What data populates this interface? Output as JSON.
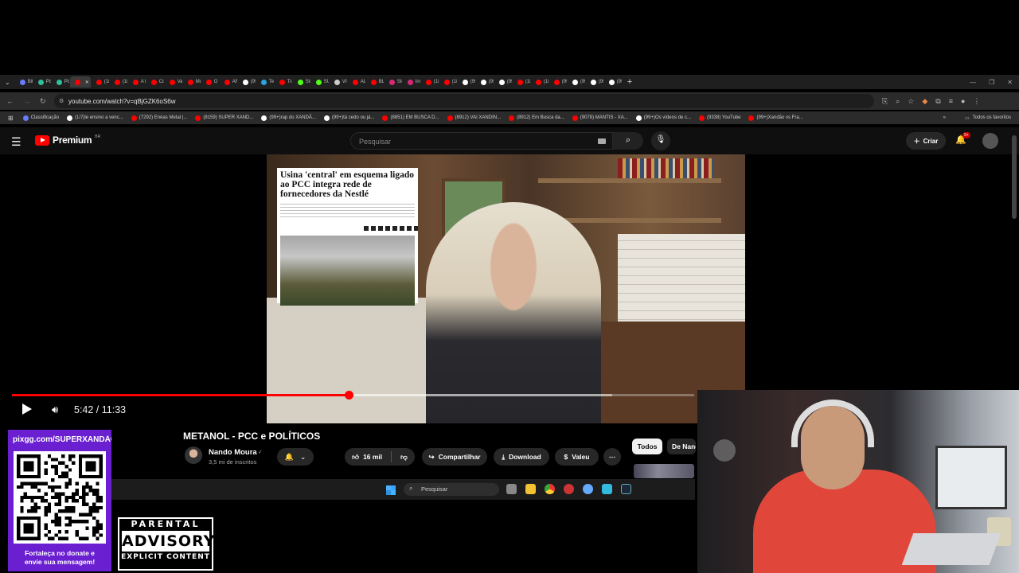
{
  "browser": {
    "tabs": [
      {
        "label": "Bit",
        "color": "#6a7bff"
      },
      {
        "label": "Pix",
        "color": "#2fbf9a"
      },
      {
        "label": "Pix",
        "color": "#2fbf9a"
      },
      {
        "label": "",
        "color": "#ff0000",
        "active": true
      },
      {
        "label": "(18",
        "color": "#ff0000"
      },
      {
        "label": "(18",
        "color": "#ff0000"
      },
      {
        "label": "A F",
        "color": "#ff0000"
      },
      {
        "label": "Co",
        "color": "#ff0000"
      },
      {
        "label": "Vai",
        "color": "#ff0000"
      },
      {
        "label": "Mu",
        "color": "#ff0000"
      },
      {
        "label": "O F",
        "color": "#ff0000"
      },
      {
        "label": "AR",
        "color": "#ff0000"
      },
      {
        "label": "(99",
        "color": "#ffffff"
      },
      {
        "label": "Tel",
        "color": "#2aa3e0"
      },
      {
        "label": "Tra",
        "color": "#ff0000"
      },
      {
        "label": "Str",
        "color": "#53fc18"
      },
      {
        "label": "SU",
        "color": "#53fc18"
      },
      {
        "label": "VIF",
        "color": "#cccccc"
      },
      {
        "label": "AL",
        "color": "#ff0000"
      },
      {
        "label": "BL",
        "color": "#ff0000"
      },
      {
        "label": "Str",
        "color": "#d62976"
      },
      {
        "label": "Inv",
        "color": "#d62976"
      },
      {
        "label": "(18",
        "color": "#ff0000"
      },
      {
        "label": "(18",
        "color": "#ff0000"
      },
      {
        "label": "(99",
        "color": "#ffffff"
      },
      {
        "label": "(99",
        "color": "#ffffff"
      },
      {
        "label": "(99",
        "color": "#ffffff"
      },
      {
        "label": "(18",
        "color": "#ff0000"
      },
      {
        "label": "(18",
        "color": "#ff0000"
      },
      {
        "label": "(99",
        "color": "#ff0000"
      },
      {
        "label": "(99",
        "color": "#ffffff"
      },
      {
        "label": "(99",
        "color": "#ffffff"
      },
      {
        "label": "(99",
        "color": "#ffffff"
      }
    ],
    "new_tab": "+",
    "url": "youtube.com/watch?v=qBjGZK6oS6w",
    "bookmarks": [
      {
        "label": "Classificação",
        "color": "#6a7bff"
      },
      {
        "label": "(1/7)le ensino a venc...",
        "color": "#ffffff"
      },
      {
        "label": "(7292) Enéas Metal |...",
        "color": "#ff0000"
      },
      {
        "label": "(8159) SUPER XAND...",
        "color": "#ff0000"
      },
      {
        "label": "(99+)rap do XANDÃ...",
        "color": "#ffffff"
      },
      {
        "label": "(99+)tá cedo ou já...",
        "color": "#ffffff"
      },
      {
        "label": "(8851) EM BUSCA D...",
        "color": "#ff0000"
      },
      {
        "label": "(8912) VAI XANDIN...",
        "color": "#ff0000"
      },
      {
        "label": "(8912) Em Busca da...",
        "color": "#ff0000"
      },
      {
        "label": "(9078) MANTIS - XA...",
        "color": "#ff0000"
      },
      {
        "label": "(99+)Os vídeos de c...",
        "color": "#ffffff"
      },
      {
        "label": "(9338) YouTube",
        "color": "#ff0000"
      },
      {
        "label": "(99+)Xandão vs Fra...",
        "color": "#ff0000"
      }
    ],
    "all_favorites": "Todos os favoritos"
  },
  "youtube": {
    "logo_text": "Premium",
    "logo_region": "BR",
    "search_placeholder": "Pesquisar",
    "create_label": "Criar",
    "notifications_badge": "9+",
    "player": {
      "current_time": "5:42",
      "duration": "11:33",
      "time_display": "5:42 / 11:33",
      "progress_fraction": 0.494,
      "buffered_fraction": 0.88
    },
    "article_overlay": {
      "headline": "Usina 'central' em esquema ligado ao PCC integra rede de fornecedores da Nestlé"
    },
    "video": {
      "title": "METANOL - PCC e POLÍTICOS",
      "channel": "Nando Moura",
      "verified": "✓",
      "subscribers": "3,5 mi de inscritos",
      "likes": "16 mil",
      "share_label": "Compartilhar",
      "download_label": "Download",
      "thanks_label": "Valeu",
      "more_label": "⋯"
    },
    "chips": {
      "all": "Todos",
      "from_channel": "De Nando Moura"
    }
  },
  "taskbar": {
    "search_placeholder": "Pesquisar"
  },
  "overlay": {
    "qr_url": "pixgg.com/SUPERXANDÃO",
    "qr_caption_line1": "Fortaleça no donate e",
    "qr_caption_line2": "envie sua mensagem!",
    "advisory_line1": "PARENTAL",
    "advisory_line2": "ADVISORY",
    "advisory_line3": "EXPLICIT CONTENT"
  }
}
